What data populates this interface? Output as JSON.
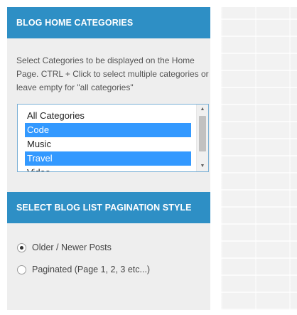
{
  "categories_section": {
    "title": "BLOG HOME CATEGORIES",
    "description": "Select Categories to be displayed on the Home Page. CTRL + Click to select multiple categories or leave empty for \"all categories\"",
    "options": [
      {
        "label": "All Categories",
        "selected": false
      },
      {
        "label": "Code",
        "selected": true
      },
      {
        "label": "Music",
        "selected": false
      },
      {
        "label": "Travel",
        "selected": true
      },
      {
        "label": "Video",
        "selected": false
      }
    ]
  },
  "pagination_section": {
    "title": "SELECT BLOG LIST PAGINATION STYLE",
    "options": [
      {
        "label": "Older / Newer Posts",
        "checked": true
      },
      {
        "label": "Paginated (Page 1, 2, 3 etc...)",
        "checked": false
      }
    ]
  },
  "colors": {
    "header_bg": "#2e8fc5",
    "selected_bg": "#3399ff",
    "panel_bg": "#eeeeee"
  }
}
